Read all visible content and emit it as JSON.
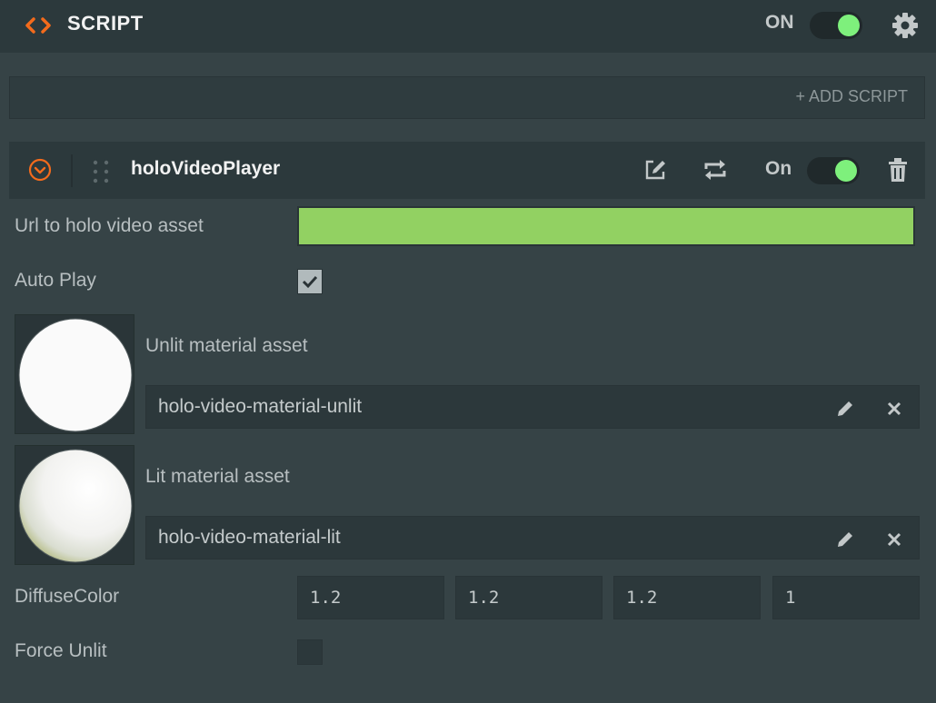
{
  "header": {
    "title": "SCRIPT",
    "toggle_label": "ON",
    "toggle_on": true,
    "accent_color": "#f36b1c",
    "toggle_color": "#7ef07c"
  },
  "add_script": {
    "label": "+ ADD SCRIPT"
  },
  "component": {
    "name": "holoVideoPlayer",
    "toggle_label": "On",
    "toggle_on": true
  },
  "attributes": {
    "url": {
      "label": "Url to holo video asset",
      "value": "",
      "color": "#92d162"
    },
    "auto_play": {
      "label": "Auto Play",
      "checked": true
    },
    "unlit": {
      "label": "Unlit material asset",
      "value": "holo-video-material-unlit"
    },
    "lit": {
      "label": "Lit material asset",
      "value": "holo-video-material-lit"
    },
    "diffuse": {
      "label": "DiffuseColor",
      "values": [
        "1.2",
        "1.2",
        "1.2",
        "1"
      ]
    },
    "force_unlit": {
      "label": "Force Unlit",
      "checked": false
    }
  },
  "icons": {
    "header_icon": "code-brackets-icon",
    "settings": "gear-icon",
    "collapse": "collapse-arrow-icon",
    "drag": "drag-handle-icon",
    "edit": "edit-icon",
    "swap": "swap-icon",
    "delete": "trash-icon",
    "clear": "close-icon",
    "pencil": "pencil-icon",
    "check": "checkmark-icon"
  }
}
